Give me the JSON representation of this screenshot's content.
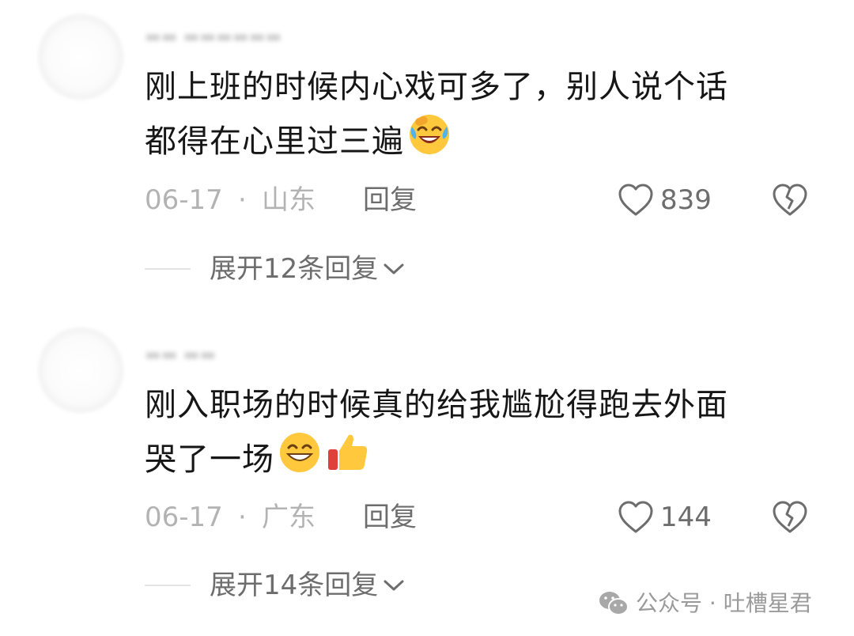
{
  "comments": [
    {
      "text_line1": "刚上班的时候内心戏可多了，别人说个话",
      "text_line2": "都得在心里过三遍",
      "emojis": [
        "laughing-tears-emoji"
      ],
      "date": "06-17",
      "separator": "·",
      "location": "山东",
      "reply_label": "回复",
      "like_count": "839",
      "expand_label": "展开12条回复"
    },
    {
      "text_line1": "刚入职场的时候真的给我尴尬得跑去外面",
      "text_line2": "哭了一场",
      "emojis": [
        "grin-sweat-emoji",
        "thumbs-up-emoji"
      ],
      "date": "06-17",
      "separator": "·",
      "location": "广东",
      "reply_label": "回复",
      "like_count": "144",
      "expand_label": "展开14条回复"
    }
  ],
  "watermark": {
    "text": "公众号 · 吐槽星君",
    "icon": "wechat-icon"
  },
  "colors": {
    "text_primary": "#161616",
    "text_meta": "#b3b3b3",
    "text_action": "#6d6d6d",
    "background": "#ffffff"
  }
}
